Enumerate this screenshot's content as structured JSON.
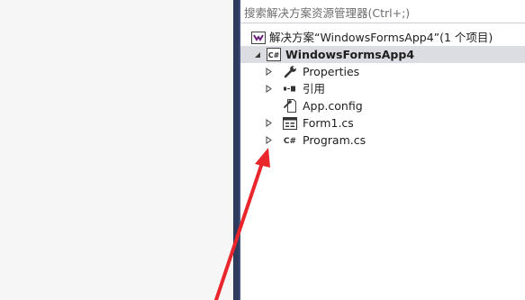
{
  "search": {
    "placeholder": "搜索解决方案资源管理器(Ctrl+;)"
  },
  "tree": {
    "solution": {
      "label": "解决方案“WindowsFormsApp4”(1 个项目)",
      "icon": "solution-icon"
    },
    "project": {
      "label": "WindowsFormsApp4",
      "icon": "csharp-project-icon",
      "expanded": true,
      "selected": true
    },
    "items": [
      {
        "label": "Properties",
        "icon": "wrench-icon",
        "expandable": true
      },
      {
        "label": "引用",
        "icon": "references-icon",
        "expandable": true
      },
      {
        "label": "App.config",
        "icon": "config-file-icon",
        "expandable": false
      },
      {
        "label": "Form1.cs",
        "icon": "form-icon",
        "expandable": true
      },
      {
        "label": "Program.cs",
        "icon": "csharp-file-icon",
        "expandable": true
      }
    ]
  },
  "colors": {
    "splitter": "#2d3a5b",
    "selection": "#dcdce3",
    "annotation_arrow": "#e8262b"
  }
}
